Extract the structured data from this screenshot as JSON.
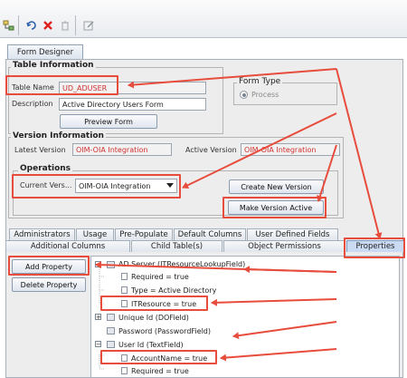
{
  "form_designer_tab": "Form Designer",
  "table_info": {
    "title": "Table Information",
    "table_name_label": "Table Name",
    "table_name_value": "UD_ADUSER",
    "description_label": "Description",
    "description_value": "Active Directory Users Form",
    "preview_button": "Preview Form"
  },
  "form_type": {
    "title": "Form Type",
    "option": "Process"
  },
  "version_info": {
    "title": "Version Information",
    "latest_label": "Latest Version",
    "latest_value": "OIM-OIA Integration",
    "active_label": "Active Version",
    "active_value": "OIM-OIA Integration"
  },
  "operations": {
    "title": "Operations",
    "current_label": "Current Vers...",
    "current_value": "OIM-OIA Integration",
    "create_button": "Create New Version",
    "make_active_button": "Make Version Active"
  },
  "tabs_row1": [
    "Administrators",
    "Usage",
    "Pre-Populate",
    "Default Columns",
    "User Defined Fields"
  ],
  "tabs_row2": [
    "Additional Columns",
    "Child Table(s)",
    "Object Permissions",
    "Properties"
  ],
  "buttons": {
    "add_property": "Add Property",
    "delete_property": "Delete Property"
  },
  "tree": [
    {
      "text": "AD Server (ITResourceLookupField)"
    },
    {
      "text": "Required = true"
    },
    {
      "text": "Type = Active Directory"
    },
    {
      "text": "ITResource = true"
    },
    {
      "text": "Unique Id (DOField)"
    },
    {
      "text": "Password (PasswordField)"
    },
    {
      "text": "User Id (TextField)"
    },
    {
      "text": "AccountName = true"
    },
    {
      "text": "Required = true"
    }
  ],
  "colors": {
    "highlight": "#e74c3c",
    "readonly_value": "#d03030",
    "active_tab": "#c9daf2"
  }
}
